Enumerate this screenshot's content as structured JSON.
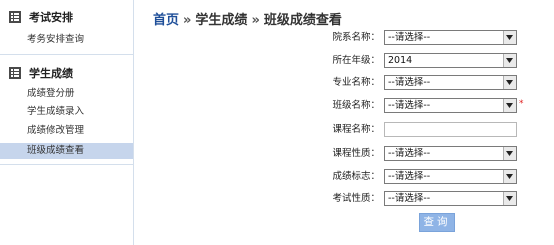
{
  "sidebar": {
    "groups": [
      {
        "icon": "list-icon",
        "title": "考试安排",
        "items": [
          "考务安排查询"
        ]
      },
      {
        "icon": "list-icon",
        "title": "学生成绩",
        "items": [
          "成绩登分册",
          "学生成绩录入",
          "成绩修改管理",
          "班级成绩查看"
        ]
      }
    ],
    "active_item": "班级成绩查看"
  },
  "breadcrumb": {
    "home": "首页",
    "separator": "»",
    "section": "学生成绩",
    "current": "班级成绩查看"
  },
  "form": {
    "dept": {
      "label": "院系名称：",
      "value": "--请选择--"
    },
    "grade": {
      "label": "所在年级：",
      "value": "2014"
    },
    "major": {
      "label": "专业名称：",
      "value": "--请选择--"
    },
    "class": {
      "label": "班级名称：",
      "value": "--请选择--",
      "required_mark": "*"
    },
    "course": {
      "label": "课程名称：",
      "value": ""
    },
    "nature": {
      "label": "课程性质：",
      "value": "--请选择--"
    },
    "flag": {
      "label": "成绩标志：",
      "value": "--请选择--"
    },
    "examtype": {
      "label": "考试性质：",
      "value": "--请选择--"
    },
    "query_button": "查询"
  },
  "colors": {
    "active_bg": "#c6d5ec",
    "link": "#1f4f99",
    "button_bg": "#8fb4e6"
  }
}
